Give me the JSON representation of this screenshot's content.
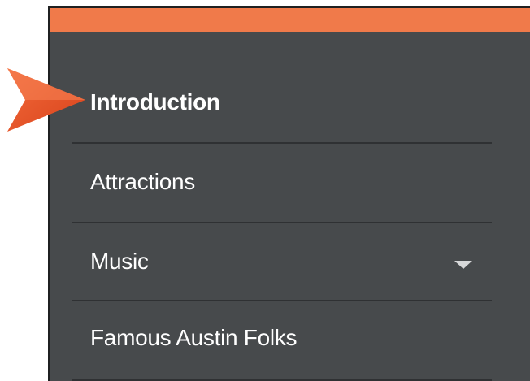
{
  "accent_color": "#f07a4a",
  "panel_color": "#474a4c",
  "menu": {
    "items": [
      {
        "label": "Introduction",
        "active": true
      },
      {
        "label": "Attractions"
      },
      {
        "label": "Music",
        "has_dropdown": true,
        "dropdown_icon": "chevron-down-icon"
      },
      {
        "label": "Famous Austin Folks"
      }
    ]
  },
  "pointer_icon": "arrow-pointer-icon"
}
